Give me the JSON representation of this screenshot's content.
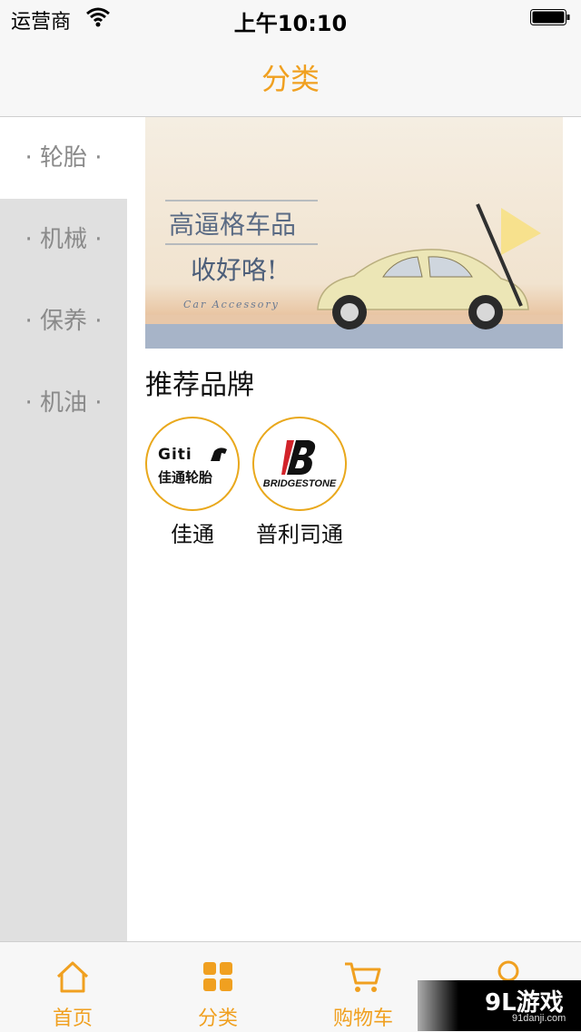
{
  "status_bar": {
    "carrier": "运营商",
    "time": "上午10:10"
  },
  "nav": {
    "title": "分类"
  },
  "sidebar": {
    "items": [
      {
        "label": "· 轮胎 ·",
        "active": true
      },
      {
        "label": "· 机械 ·",
        "active": false
      },
      {
        "label": "· 保养 ·",
        "active": false
      },
      {
        "label": "· 机油 ·",
        "active": false
      }
    ]
  },
  "banner": {
    "line1": "高逼格车品",
    "line2": "收好咯!",
    "line3": "Car Accessory"
  },
  "recommend": {
    "title": "推荐品牌",
    "brands": [
      {
        "name": "佳通",
        "logo_text": "Giti",
        "logo_sub": "佳通轮胎"
      },
      {
        "name": "普利司通",
        "logo_text": "BRIDGESTONE"
      }
    ]
  },
  "tabbar": {
    "items": [
      {
        "label": "首页",
        "icon": "home-icon"
      },
      {
        "label": "分类",
        "icon": "grid-icon"
      },
      {
        "label": "购物车",
        "icon": "cart-icon"
      },
      {
        "label": "",
        "icon": "user-icon"
      }
    ]
  },
  "watermark": {
    "brand": "9L游戏",
    "site": "91danji.com"
  },
  "colors": {
    "accent": "#f0a020",
    "sidebar_bg": "#e0e0e0",
    "brand_ring": "#e9a81c"
  }
}
